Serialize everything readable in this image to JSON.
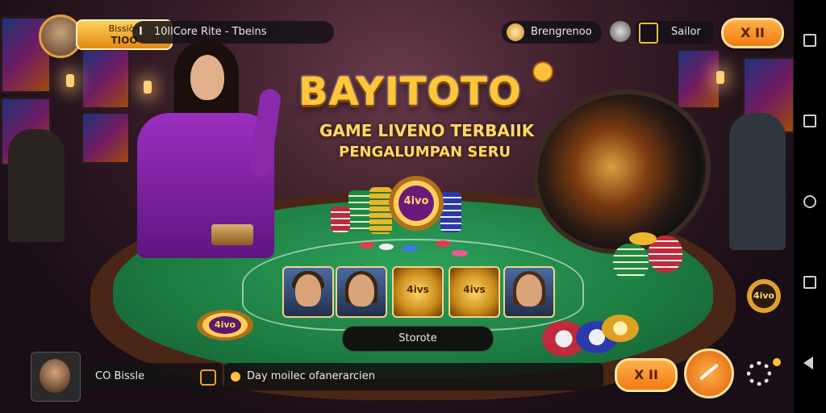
{
  "header": {
    "player_label_top": "Bissiòn",
    "player_label_bottom": "TIOO",
    "marquee_icon": "I",
    "marquee_text": "10llCore Rite - Tbeins",
    "coin_label": "Brengrenoo",
    "sailor_label": "Sailor",
    "multiplier_label": "X II"
  },
  "banner": {
    "logo": "BAYITOTO",
    "tagline_1": "GAME LIVENO TERBAIIK",
    "tagline_2": "PENGALUMPAN SERU"
  },
  "table": {
    "center_chip_text": "4ivo",
    "cards": [
      {
        "type": "player",
        "name": "man"
      },
      {
        "type": "player",
        "name": "woman"
      },
      {
        "type": "coin",
        "text": "4ivs"
      },
      {
        "type": "coin",
        "text": "4ivs"
      },
      {
        "type": "player",
        "name": "woman"
      }
    ],
    "plaque_text": "4ivo",
    "side_coin_text": "4ivo",
    "center_button_label": "Storote"
  },
  "footer": {
    "username": "CO Bissle",
    "message": "Day moilec ofanerarcien",
    "multiplier_label": "X II"
  },
  "colors": {
    "accent_orange": "#f07a12",
    "gold": "#ffc63a",
    "felt_green": "#1c7a40"
  },
  "icons": [
    "avatar-icon",
    "coin-icon",
    "joker-icon",
    "flag-icon",
    "pencil-icon",
    "gear-icon",
    "square-nav-icon",
    "home-nav-icon",
    "back-nav-icon"
  ]
}
